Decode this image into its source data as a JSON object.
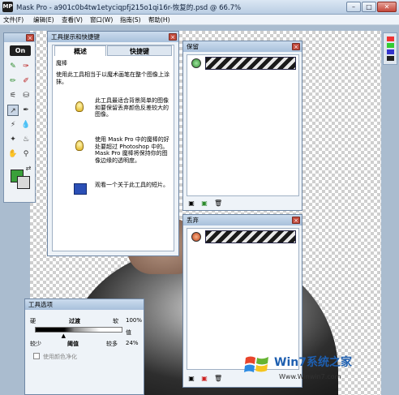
{
  "window": {
    "title": "Mask Pro - a901c0b4tw1etyciqpfj215o1qi16r-恢复的.psd @ 66.7%",
    "app_icon_text": "MP",
    "min_label": "–",
    "max_label": "□",
    "close_label": "✕"
  },
  "menu": [
    {
      "label": "文件(F)"
    },
    {
      "label": "编辑(E)"
    },
    {
      "label": "查看(V)"
    },
    {
      "label": "窗口(W)"
    },
    {
      "label": "指南(S)"
    },
    {
      "label": "帮助(H)"
    }
  ],
  "tools": {
    "logo": "On",
    "icons": [
      "brush-icon",
      "eyedropper-icon",
      "paint-brush-icon",
      "pencil-icon",
      "magic-brush-icon",
      "bucket-icon",
      "magic-pen-icon",
      "pen-icon",
      "wand-icon",
      "drop-icon",
      "hand-icon",
      "zoom-icon"
    ]
  },
  "hints_panel": {
    "title": "工具提示和快捷键",
    "tab_overview": "概述",
    "tab_shortcuts": "快捷键",
    "tool_name": "魔棒",
    "tool_desc": "使用此工具相当于以魔术画笔在整个图像上涂抹。",
    "tip1": "此工具最适合背景简单的图像和要保留丢弃颜色反差较大的图像。",
    "tip2": "使用 Mask Pro 中的魔棒的好处要超过 Photoshop 中的。Mask Pro 魔棒将保持你的图像边缘的透明度。",
    "tip3": "观看一个关于此工具的短片。"
  },
  "keep_panel": {
    "title": "保留",
    "footer_icons": [
      "new-swatch-icon",
      "eyedropper-add-icon",
      "trash-icon"
    ]
  },
  "drop_panel": {
    "title": "丢弃",
    "footer_icons": [
      "new-swatch-icon",
      "eyedropper-add-icon",
      "trash-icon"
    ]
  },
  "options_panel": {
    "title": "工具选项",
    "hard": "硬",
    "transition": "过渡",
    "soft": "软",
    "percent_top": "100%",
    "value": "值",
    "less": "较少",
    "threshold": "阈值",
    "more": "较多",
    "percent_bottom": "24%",
    "purify_label": "使用颜色净化",
    "threshold_fraction": 0.33
  },
  "watermark": {
    "brand": "Win7系统之家",
    "url": "Www.Winwin7.com"
  },
  "colors": {
    "keep_dot": "#3aa03a",
    "drop_dot": "#d04a1a",
    "close_red": "#c44d3f"
  }
}
